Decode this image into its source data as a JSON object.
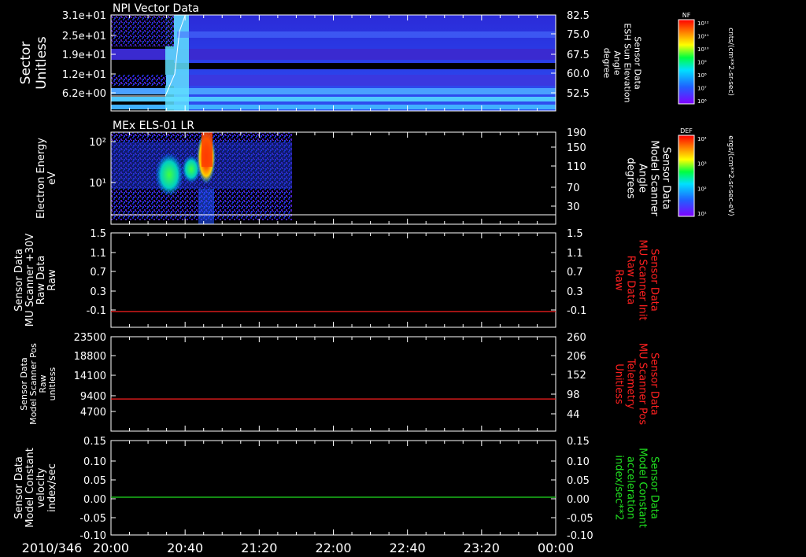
{
  "date_label": "2010/346",
  "time_ticks": [
    "20:00",
    "20:40",
    "21:20",
    "22:00",
    "22:40",
    "23:20",
    "00:00"
  ],
  "chart_data": [
    {
      "type": "heatmap",
      "title": "NPI Vector Data",
      "ylabel_left": [
        "Sector",
        "Unitless"
      ],
      "yticks_left": [
        "3.1e+01",
        "2.5e+01",
        "1.9e+01",
        "1.2e+01",
        "6.2e+00"
      ],
      "ylabel_right": [
        "Sensor Data",
        "ESH Sun Elevation",
        "Angle",
        "degree"
      ],
      "yticks_right": [
        "82.5",
        "75.0",
        "67.5",
        "60.0",
        "52.5"
      ],
      "colorbar": {
        "title": "NF",
        "label": "cnts/(cm**2-sr-sec)",
        "ticks": [
          "10¹²",
          "10¹¹",
          "10¹⁰",
          "10⁹",
          "10⁸",
          "10⁷",
          "10⁶"
        ]
      }
    },
    {
      "type": "heatmap",
      "title": "MEx ELS-01 LR",
      "ylabel_left": [
        "Electron Energy",
        "eV"
      ],
      "yticks_left": [
        "10²",
        "10¹"
      ],
      "ylabel_right": [
        "Sensor Data",
        "Model Scanner",
        "Angle",
        "degrees"
      ],
      "yticks_right": [
        "190",
        "150",
        "110",
        "70",
        "30"
      ],
      "colorbar": {
        "title": "DEF",
        "label": "ergs/(cm**2-sr-sec-eV)",
        "ticks": [
          "10⁴",
          "10³",
          "10²",
          "10¹"
        ]
      }
    },
    {
      "type": "line",
      "ylabel_left": [
        "Sensor Data",
        "MU Scanner +30V",
        "Raw Data",
        "Raw"
      ],
      "yticks_left": [
        "1.5",
        "1.1",
        "0.7",
        "0.3",
        "-0.1"
      ],
      "ylabel_right": [
        "Sensor Data",
        "MU Scanner Init",
        "Raw Data",
        "Raw"
      ],
      "yticks_right": [
        "1.5",
        "1.1",
        "0.7",
        "0.3",
        "-0.1"
      ],
      "ylim": [
        -0.3,
        1.5
      ],
      "series": [
        {
          "values": [
            0.0,
            0.0
          ],
          "color": "#ff2020"
        }
      ]
    },
    {
      "type": "line",
      "ylabel_left": [
        "Sensor Data",
        "Model Scanner Pos",
        "Raw",
        "unitless"
      ],
      "yticks_left": [
        "23500",
        "18800",
        "14100",
        "9400",
        "4700"
      ],
      "ylabel_right": [
        "Sensor Data",
        "MU Scanner Pos",
        "Telemetry",
        "Unitless"
      ],
      "yticks_right": [
        "260",
        "206",
        "152",
        "98",
        "44"
      ],
      "ylim": [
        0,
        23500
      ],
      "series": [
        {
          "values": [
            8000,
            8000
          ],
          "color": "#ff2020"
        }
      ]
    },
    {
      "type": "line",
      "ylabel_left": [
        "Sensor Data",
        "Model Constant",
        "velocity",
        "index/sec"
      ],
      "yticks_left": [
        "0.15",
        "0.10",
        "0.05",
        "0.00",
        "-0.05",
        "-0.10"
      ],
      "ylabel_right": [
        "Sensor Data",
        "Model Constant",
        "acceleration",
        "index/sec**2"
      ],
      "yticks_right": [
        "0.15",
        "0.10",
        "0.05",
        "0.00",
        "-0.05",
        "-0.10"
      ],
      "ylim": [
        -0.1,
        0.15
      ],
      "series": [
        {
          "values": [
            0.0,
            0.0
          ],
          "color": "#20dd20"
        }
      ]
    }
  ],
  "colors": {
    "red_label": "#ff2020",
    "green_label": "#20e020"
  }
}
